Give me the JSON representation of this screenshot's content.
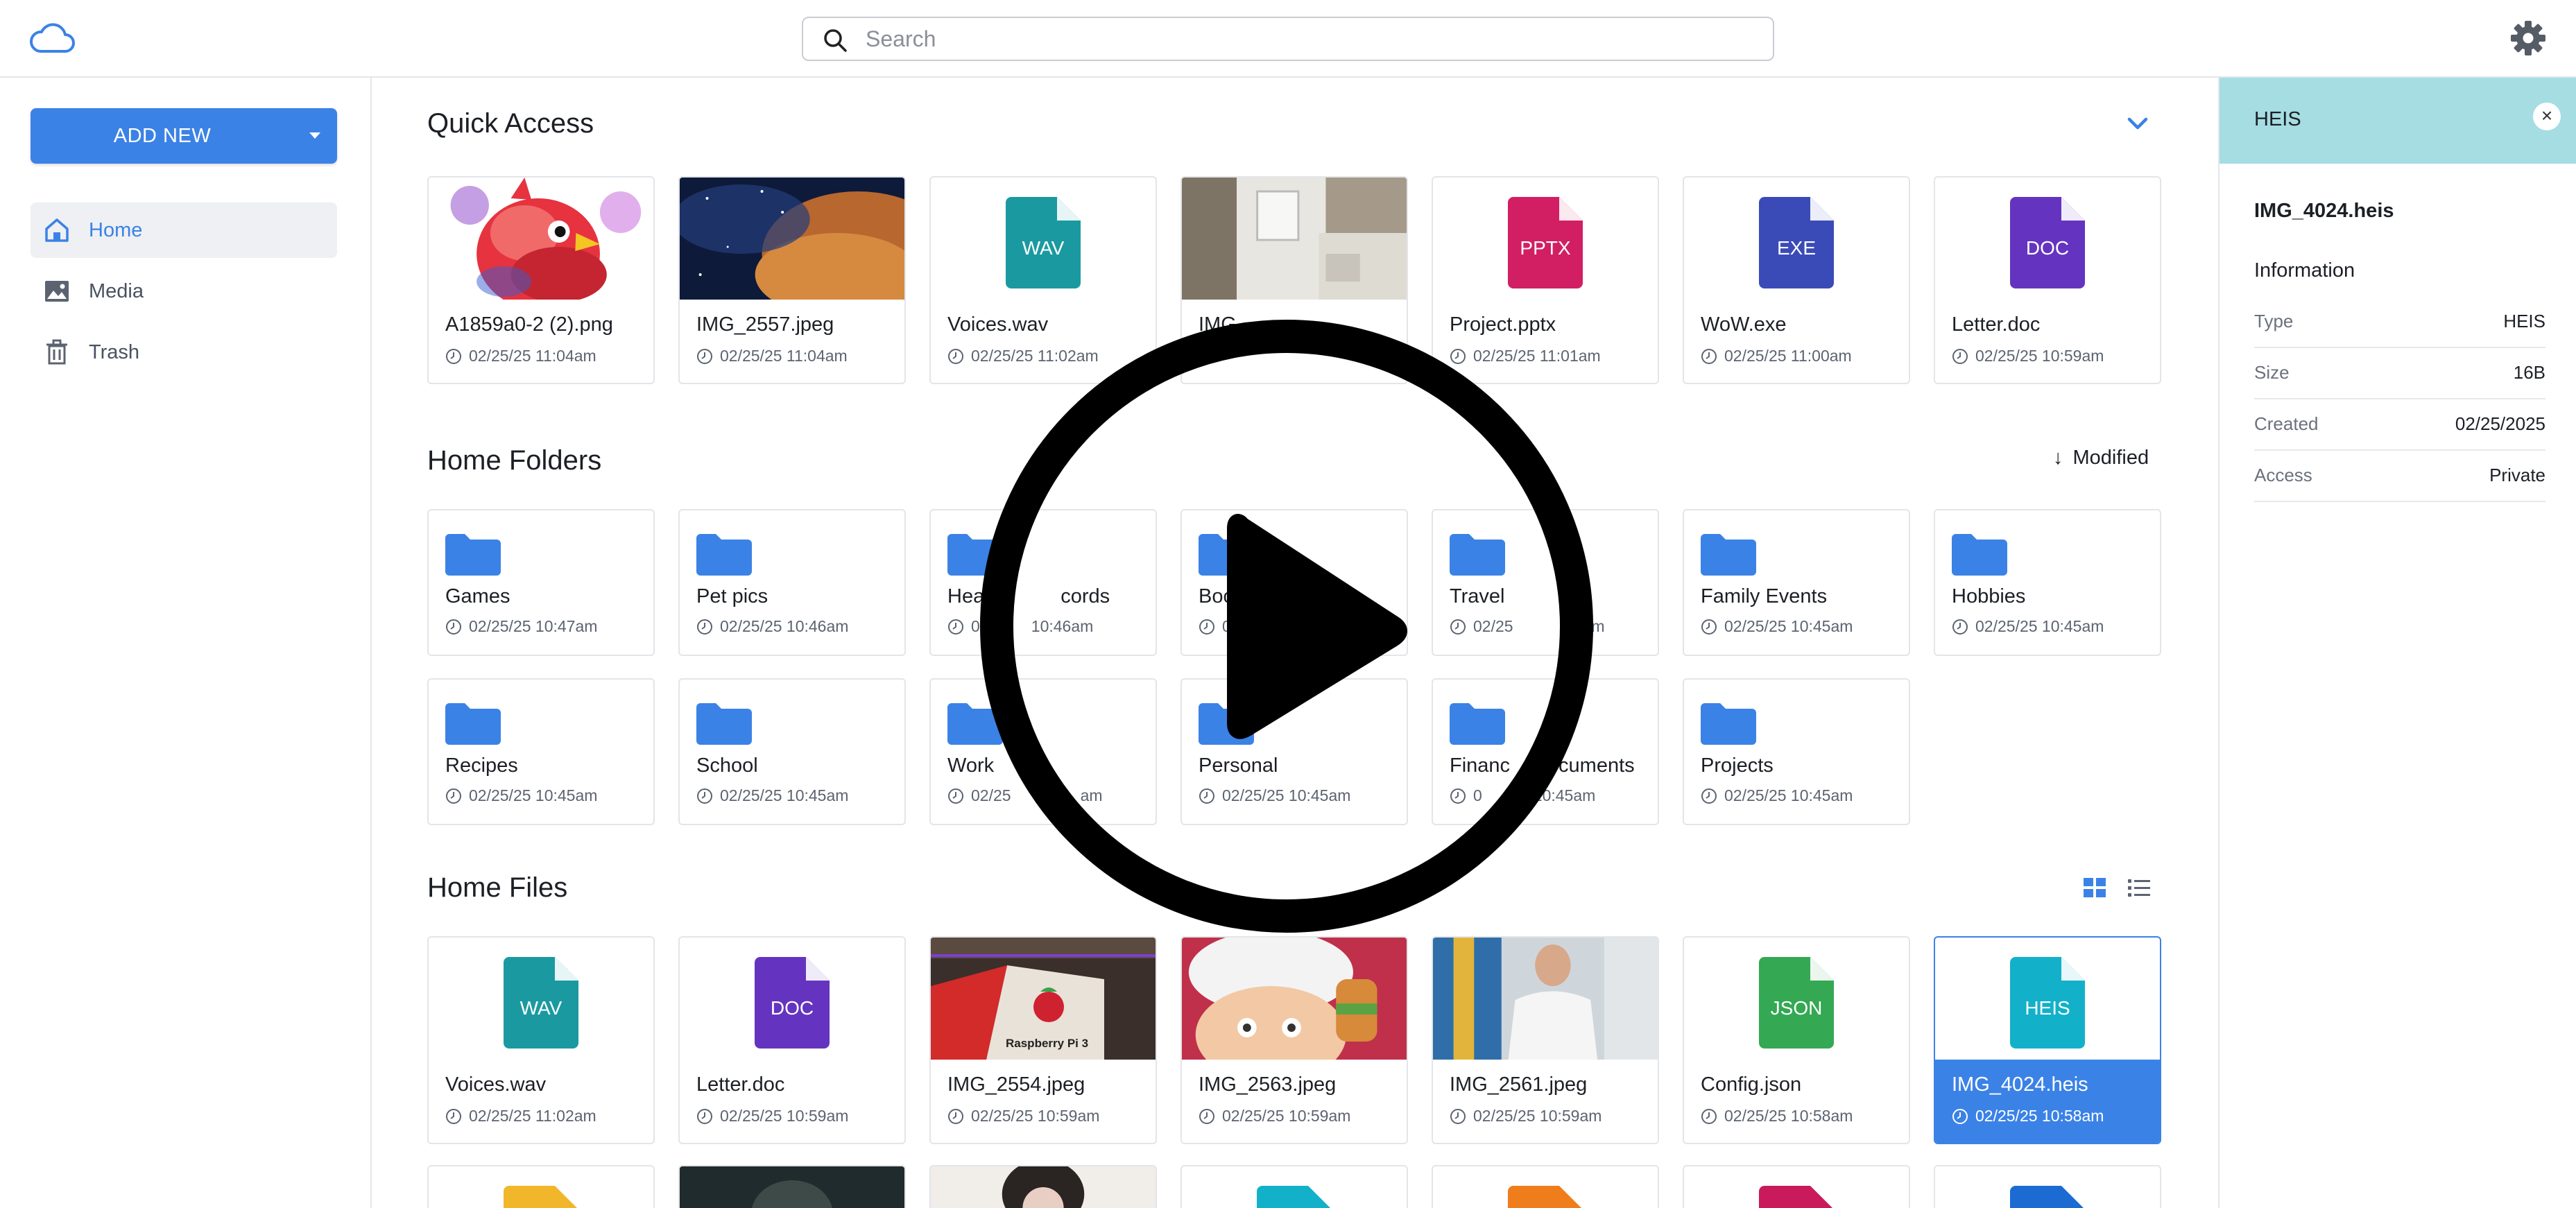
{
  "header": {
    "logo_icon": "cloud-icon",
    "search_placeholder": "Search",
    "settings_icon": "gear-icon"
  },
  "colors": {
    "accent": "#3b82e6",
    "panel_header": "#a5dde3",
    "wav": "#1a9aa0",
    "doc": "#6434c0",
    "pptx": "#d21f63",
    "exe": "#3a4bb8",
    "json": "#34a853",
    "heis": "#12b1c9"
  },
  "sidebar": {
    "add_new_label": "ADD NEW",
    "items": [
      {
        "label": "Home",
        "icon": "home-icon",
        "active": true
      },
      {
        "label": "Media",
        "icon": "image-icon",
        "active": false
      },
      {
        "label": "Trash",
        "icon": "trash-icon",
        "active": false
      }
    ]
  },
  "quick_access": {
    "title": "Quick Access",
    "items": [
      {
        "name": "A1859a0-2 (2).png",
        "date": "02/25/25 11:04am",
        "kind": "image"
      },
      {
        "name": "IMG_2557.jpeg",
        "date": "02/25/25 11:04am",
        "kind": "image"
      },
      {
        "name": "Voices.wav",
        "date": "02/25/25 11:02am",
        "kind": "doc",
        "ext": "WAV"
      },
      {
        "name": "IMG_",
        "date": "",
        "kind": "image"
      },
      {
        "name": "Project.pptx",
        "date": "02/25/25 11:01am",
        "kind": "doc",
        "ext": "PPTX"
      },
      {
        "name": "WoW.exe",
        "date": "02/25/25 11:00am",
        "kind": "doc",
        "ext": "EXE"
      },
      {
        "name": "Letter.doc",
        "date": "02/25/25 10:59am",
        "kind": "doc",
        "ext": "DOC"
      }
    ]
  },
  "home_folders": {
    "title": "Home Folders",
    "sort_label": "Modified",
    "items": [
      {
        "name": "Games",
        "date": "02/25/25 10:47am"
      },
      {
        "name": "Pet pics",
        "date": "02/25/25 10:46am"
      },
      {
        "name": "Hea",
        "name_tail": "cords",
        "date": "0",
        "date_tail": "10:46am"
      },
      {
        "name": "Book",
        "date": "0"
      },
      {
        "name": "Travel",
        "date": "02/25",
        "date_tail": "am"
      },
      {
        "name": "Family Events",
        "date": "02/25/25 10:45am"
      },
      {
        "name": "Hobbies",
        "date": "02/25/25 10:45am"
      },
      {
        "name": "Recipes",
        "date": "02/25/25 10:45am"
      },
      {
        "name": "School",
        "date": "02/25/25 10:45am"
      },
      {
        "name": "Work",
        "date": "02/25",
        "date_tail": "am"
      },
      {
        "name": "Personal",
        "date": "02/25/25 10:45am"
      },
      {
        "name": "Financ",
        "name_tail": "cuments",
        "date": "0",
        "date_tail": "10:45am"
      },
      {
        "name": "Projects",
        "date": "02/25/25 10:45am"
      }
    ]
  },
  "home_files": {
    "title": "Home Files",
    "items": [
      {
        "name": "Voices.wav",
        "date": "02/25/25 11:02am",
        "kind": "doc",
        "ext": "WAV"
      },
      {
        "name": "Letter.doc",
        "date": "02/25/25 10:59am",
        "kind": "doc",
        "ext": "DOC"
      },
      {
        "name": "IMG_2554.jpeg",
        "date": "02/25/25 10:59am",
        "kind": "image",
        "caption": "Raspberry Pi 3"
      },
      {
        "name": "IMG_2563.jpeg",
        "date": "02/25/25 10:59am",
        "kind": "image"
      },
      {
        "name": "IMG_2561.jpeg",
        "date": "02/25/25 10:59am",
        "kind": "image"
      },
      {
        "name": "Config.json",
        "date": "02/25/25 10:58am",
        "kind": "doc",
        "ext": "JSON"
      },
      {
        "name": "IMG_4024.heis",
        "date": "02/25/25 10:58am",
        "kind": "doc",
        "ext": "HEIS",
        "selected": true
      }
    ]
  },
  "details": {
    "header": "HEIS",
    "file_name": "IMG_4024.heis",
    "section": "Information",
    "rows": [
      {
        "key": "Type",
        "value": "HEIS"
      },
      {
        "key": "Size",
        "value": "16B"
      },
      {
        "key": "Created",
        "value": "02/25/2025"
      },
      {
        "key": "Access",
        "value": "Private"
      }
    ]
  }
}
